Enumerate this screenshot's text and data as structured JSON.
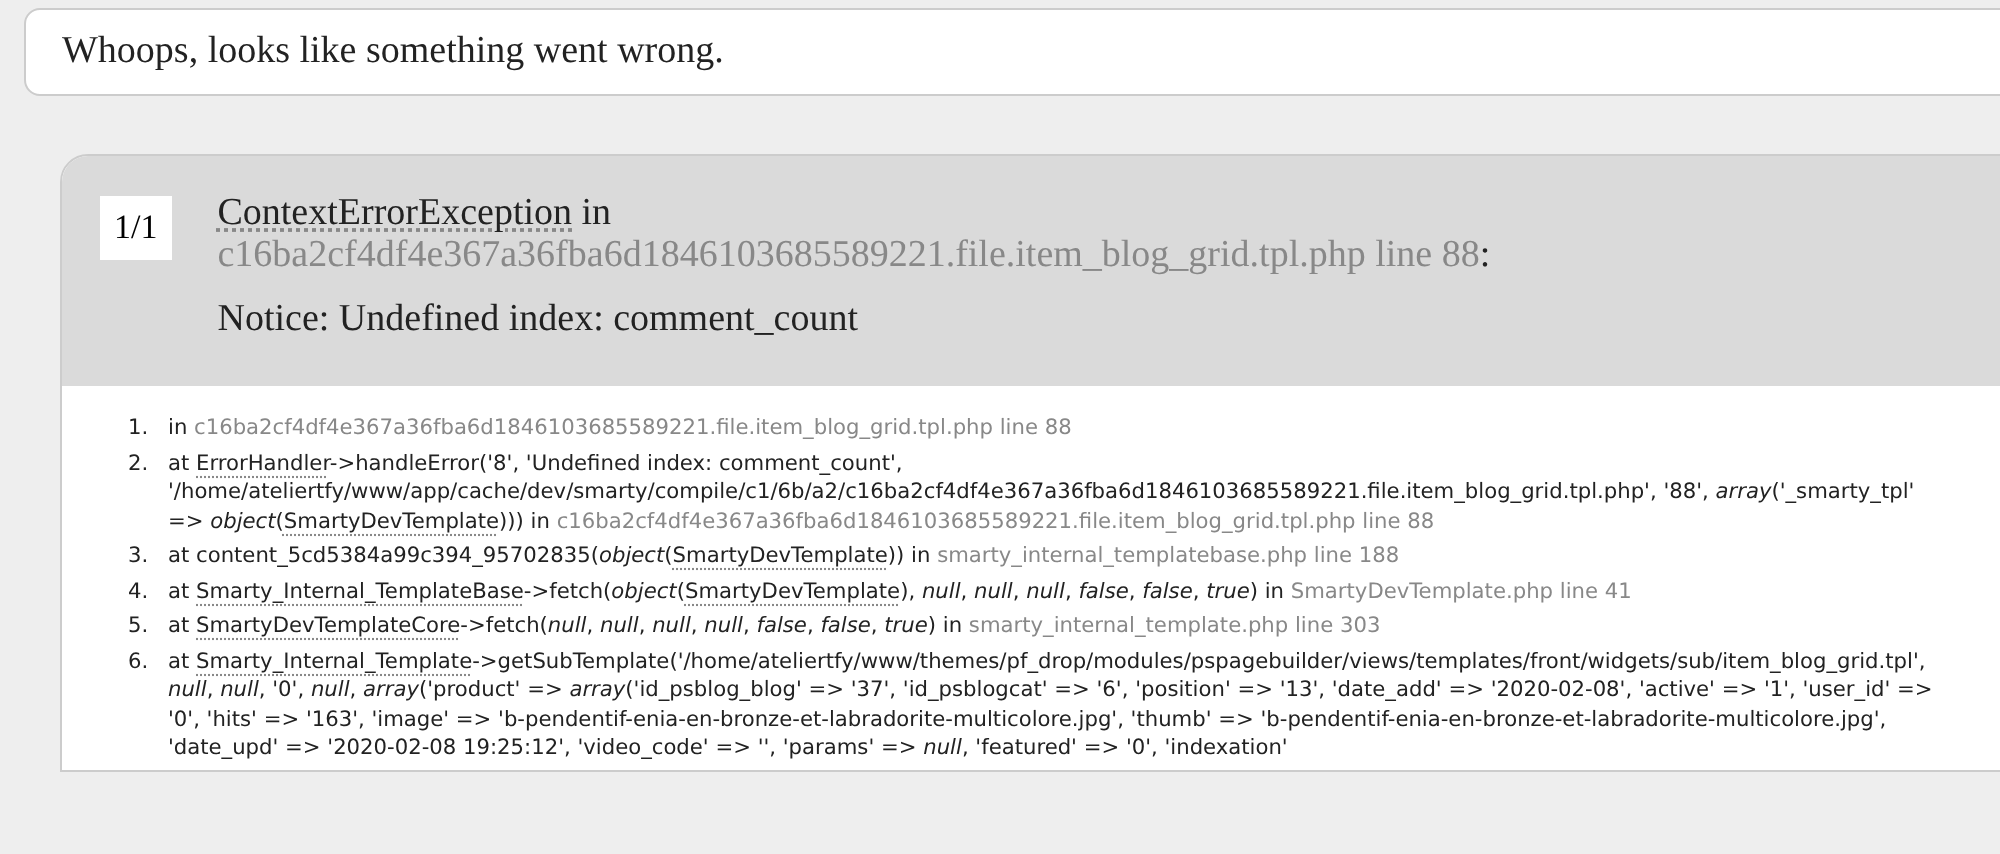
{
  "message": "Whoops, looks like something went wrong.",
  "exception": {
    "counter": "1/1",
    "class_name": "ContextErrorException",
    "in_word": "in",
    "file": "c16ba2cf4df4e367a36fba6d1846103685589221.file.item_blog_grid.tpl.php line 88",
    "colon": ":",
    "message": "Notice: Undefined index: comment_count"
  },
  "trace": [
    {
      "number": "1.",
      "parts": [
        {
          "kind": "plain",
          "text": "in "
        },
        {
          "kind": "file",
          "text": "c16ba2cf4df4e367a36fba6d1846103685589221.file.item_blog_grid.tpl.php line 88"
        }
      ]
    },
    {
      "number": "2.",
      "parts": [
        {
          "kind": "plain",
          "text": "at "
        },
        {
          "kind": "abbr",
          "text": "ErrorHandler"
        },
        {
          "kind": "plain",
          "text": "->handleError('8', 'Undefined index: comment_count', '/home/ateliertfy/www/app/cache/dev/smarty/compile/c1/6b/a2/c16ba2cf4df4e367a36fba6d1846103685589221.file.item_blog_grid.tpl.php', '88', *array*('_smarty_tpl' => *object*("
        },
        {
          "kind": "abbr",
          "text": "SmartyDevTemplate"
        },
        {
          "kind": "plain",
          "text": "))) in "
        },
        {
          "kind": "file",
          "text": "c16ba2cf4df4e367a36fba6d1846103685589221.file.item_blog_grid.tpl.php line 88"
        }
      ]
    },
    {
      "number": "3.",
      "parts": [
        {
          "kind": "plain",
          "text": "at content_5cd5384a99c394_95702835(*object*("
        },
        {
          "kind": "abbr",
          "text": "SmartyDevTemplate"
        },
        {
          "kind": "plain",
          "text": ")) in "
        },
        {
          "kind": "file",
          "text": "smarty_internal_templatebase.php line 188"
        }
      ]
    },
    {
      "number": "4.",
      "parts": [
        {
          "kind": "plain",
          "text": "at "
        },
        {
          "kind": "abbr",
          "text": "Smarty_Internal_TemplateBase"
        },
        {
          "kind": "plain",
          "text": "->fetch(*object*("
        },
        {
          "kind": "abbr",
          "text": "SmartyDevTemplate"
        },
        {
          "kind": "plain",
          "text": "), *null*, *null*, *null*, *false*, *false*, *true*) in "
        },
        {
          "kind": "file",
          "text": "SmartyDevTemplate.php line 41"
        }
      ]
    },
    {
      "number": "5.",
      "parts": [
        {
          "kind": "plain",
          "text": "at "
        },
        {
          "kind": "abbr",
          "text": "SmartyDevTemplateCore"
        },
        {
          "kind": "plain",
          "text": "->fetch(*null*, *null*, *null*, *null*, *false*, *false*, *true*) in "
        },
        {
          "kind": "file",
          "text": "smarty_internal_template.php line 303"
        }
      ]
    },
    {
      "number": "6.",
      "parts": [
        {
          "kind": "plain",
          "text": "at "
        },
        {
          "kind": "abbr",
          "text": "Smarty_Internal_Template"
        },
        {
          "kind": "plain",
          "text": "->getSubTemplate('/home/ateliertfy/www/themes/pf_drop/modules/pspagebuilder/views/templates/front/widgets/sub/item_blog_grid.tpl', *null*, *null*, '0', *null*, *array*('product' => *array*('id_psblog_blog' => '37', 'id_psblogcat' => '6', 'position' => '13', 'date_add' => '2020-02-08', 'active' => '1', 'user_id' => '0', 'hits' => '163', 'image' => 'b-pendentif-enia-en-bronze-et-labradorite-multicolore.jpg', 'thumb' => 'b-pendentif-enia-en-bronze-et-labradorite-multicolore.jpg', 'date_upd' => '2020-02-08 19:25:12', 'video_code' => '', 'params' => *null*, 'featured' => '0', 'indexation'"
        }
      ]
    }
  ]
}
